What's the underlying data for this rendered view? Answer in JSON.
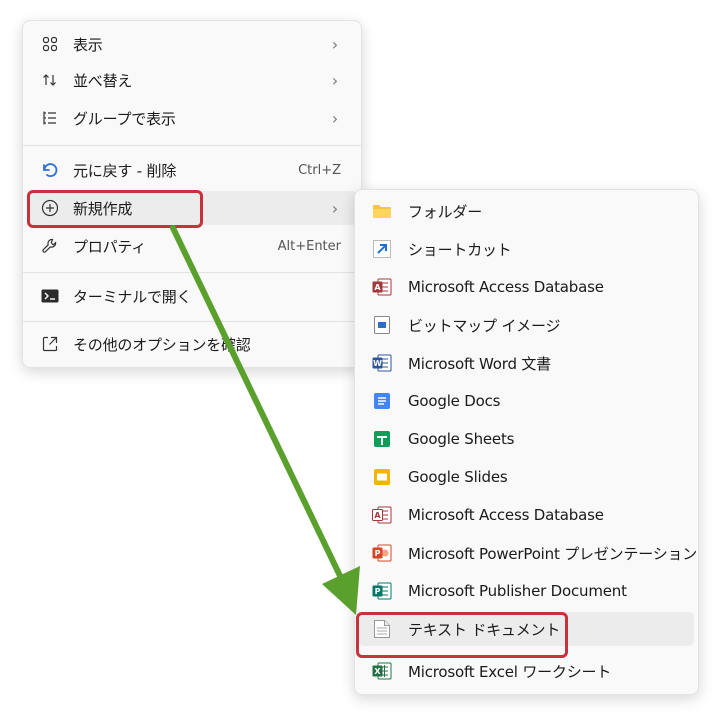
{
  "main_menu": {
    "items": [
      {
        "label": "表示",
        "icon": "grid-view-icon",
        "has_submenu": true
      },
      {
        "label": "並べ替え",
        "icon": "sort-arrows-icon",
        "has_submenu": true
      },
      {
        "label": "グループで表示",
        "icon": "group-list-icon",
        "has_submenu": true
      },
      {
        "label": "元に戻す - 削除",
        "icon": "undo-icon",
        "shortcut": "Ctrl+Z"
      },
      {
        "label": "新規作成",
        "icon": "plus-circle-icon",
        "has_submenu": true
      },
      {
        "label": "プロパティ",
        "icon": "wrench-icon",
        "shortcut": "Alt+Enter"
      },
      {
        "label": "ターミナルで開く",
        "icon": "terminal-icon"
      },
      {
        "label": "その他のオプションを確認",
        "icon": "more-options-icon"
      }
    ],
    "chevron": "›"
  },
  "sub_menu": {
    "items": [
      {
        "label": "フォルダー",
        "icon": "folder-icon"
      },
      {
        "label": "ショートカット",
        "icon": "shortcut-icon"
      },
      {
        "label": "Microsoft Access Database",
        "icon": "access-icon"
      },
      {
        "label": "ビットマップ イメージ",
        "icon": "bitmap-icon"
      },
      {
        "label": "Microsoft Word 文書",
        "icon": "word-icon"
      },
      {
        "label": "Google Docs",
        "icon": "google-docs-icon"
      },
      {
        "label": "Google Sheets",
        "icon": "google-sheets-icon"
      },
      {
        "label": "Google Slides",
        "icon": "google-slides-icon"
      },
      {
        "label": "Microsoft Access Database",
        "icon": "access-icon"
      },
      {
        "label": "Microsoft PowerPoint プレゼンテーション",
        "icon": "powerpoint-icon"
      },
      {
        "label": "Microsoft Publisher Document",
        "icon": "publisher-icon"
      },
      {
        "label": "テキスト ドキュメント",
        "icon": "text-document-icon"
      },
      {
        "label": "Microsoft Excel ワークシート",
        "icon": "excel-icon"
      }
    ]
  },
  "colors": {
    "annotation_red": "#c8323c",
    "arrow_green": "#5aa02c",
    "hover": "#ececec"
  }
}
